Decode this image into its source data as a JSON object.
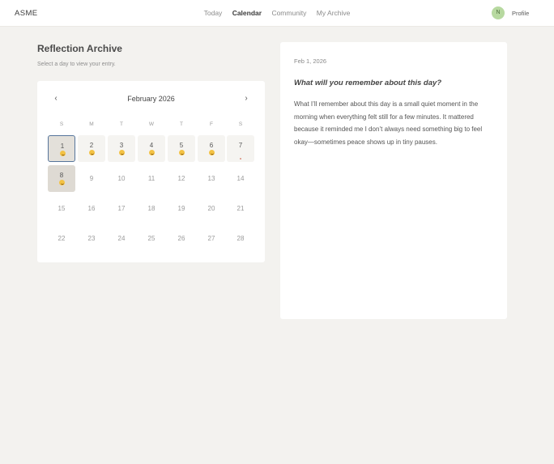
{
  "header": {
    "brand": "ASME",
    "nav": [
      "Today",
      "Calendar",
      "Community",
      "My Archive"
    ],
    "active_nav": "Calendar",
    "avatar_initial": "N",
    "profile_label": "Profile"
  },
  "archive": {
    "title": "Reflection Archive",
    "subtitle": "Select a day to view your entry."
  },
  "calendar": {
    "month_label": "February 2026",
    "prev_arrow": "‹",
    "next_arrow": "›",
    "weekdays": [
      "S",
      "M",
      "T",
      "W",
      "T",
      "F",
      "S"
    ],
    "weeks": [
      [
        "1",
        "2",
        "3",
        "4",
        "5",
        "6",
        "7"
      ],
      [
        "8",
        "9",
        "10",
        "11",
        "12",
        "13",
        "14"
      ],
      [
        "15",
        "16",
        "17",
        "18",
        "19",
        "20",
        "21"
      ],
      [
        "22",
        "23",
        "24",
        "25",
        "26",
        "27",
        "28"
      ]
    ],
    "days_with_mood": [
      "1",
      "2",
      "3",
      "4",
      "5",
      "6",
      "8"
    ],
    "days_with_dot": [
      "7"
    ],
    "selected_day": "1",
    "mood_color": "#f3c244",
    "selected_border_color": "#56759b"
  },
  "entry": {
    "date": "Feb 1, 2026",
    "question": "What will you remember about this day?",
    "body": "What I’ll remember about this day is a small quiet moment in the morning when everything felt still for a few minutes. It mattered because it reminded me I don’t always need something big to feel okay—sometimes peace shows up in tiny pauses."
  }
}
